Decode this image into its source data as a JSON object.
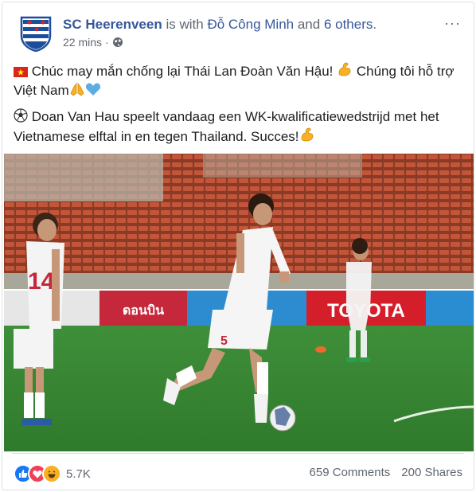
{
  "post": {
    "page_name": "SC Heerenveen",
    "with_text": "is with",
    "tagged_person": "Đỗ Công Minh",
    "and_text": "and",
    "others": "6 others",
    "trailing": ".",
    "time": "22 mins",
    "more_label": "···",
    "para1": "Chúc may mắn chống lại Thái Lan Đoàn Văn Hậu!",
    "para1_b": "Chúng tôi hỗ trợ Việt Nam",
    "para2": "Doan Van Hau speelt vandaag een WK-kwalificatiewedstrijd met het Vietnamese elftal in en tegen Thailand. Succes!",
    "photo": {
      "jersey_left": "14",
      "jersey_center": "5",
      "board_brand": "TOYOTA",
      "board_brand2": "ดอนบิน"
    }
  },
  "footer": {
    "reaction_count": "5.7K",
    "comments": "659 Comments",
    "shares": "200 Shares"
  },
  "colors": {
    "link": "#365899",
    "muted": "#606770",
    "like": "#1877f2",
    "love": "#f33e58",
    "haha": "#f7b125"
  }
}
